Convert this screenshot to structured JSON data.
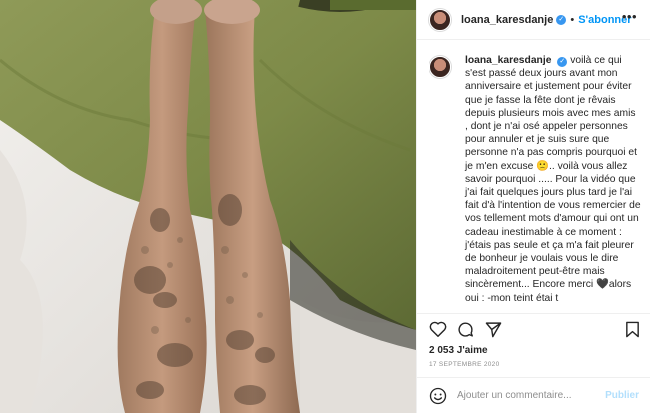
{
  "post": {
    "username": "loana_karesdanje",
    "verified_icon": "verified-badge-icon",
    "follow_separator": "•",
    "follow_label": "S'abonner",
    "more_label": "•••",
    "caption_text": "voilà ce qui s'est passé deux jours avant mon anniversaire et justement pour éviter que je fasse la fête dont je rêvais depuis plusieurs mois avec mes amis , dont je n'ai osé appeler personnes pour annuler et je suis sure que personne n'a pas compris pourquoi et je m'en excuse 🙁.. voilà vous allez savoir pourquoi ..... Pour la vidéo que j'ai fait quelques jours plus tard je l'ai fait d'à l'intention de vous remercier de vos tellement mots d'amour qui ont un cadeau inestimable à ce moment : j'étais pas seule et ça m'a fait pleurer de bonheur je voulais vous le dire maladroitement peut-être mais sincèrement... Encore merci 🖤alors oui : -mon teint étai t",
    "likes": "2 053 J'aime",
    "date": "17 SEPTEMBRE 2020"
  },
  "comment": {
    "placeholder": "Ajouter un commentaire...",
    "publish_label": "Publier"
  },
  "icons": {
    "like": "heart-icon",
    "comment": "comment-icon",
    "share": "share-icon",
    "save": "bookmark-icon",
    "emoji": "emoji-icon"
  },
  "colors": {
    "link_blue": "#0095f6",
    "publish_disabled": "#b2dffc",
    "muted_text": "#8e8e8e",
    "border": "#efefef"
  }
}
